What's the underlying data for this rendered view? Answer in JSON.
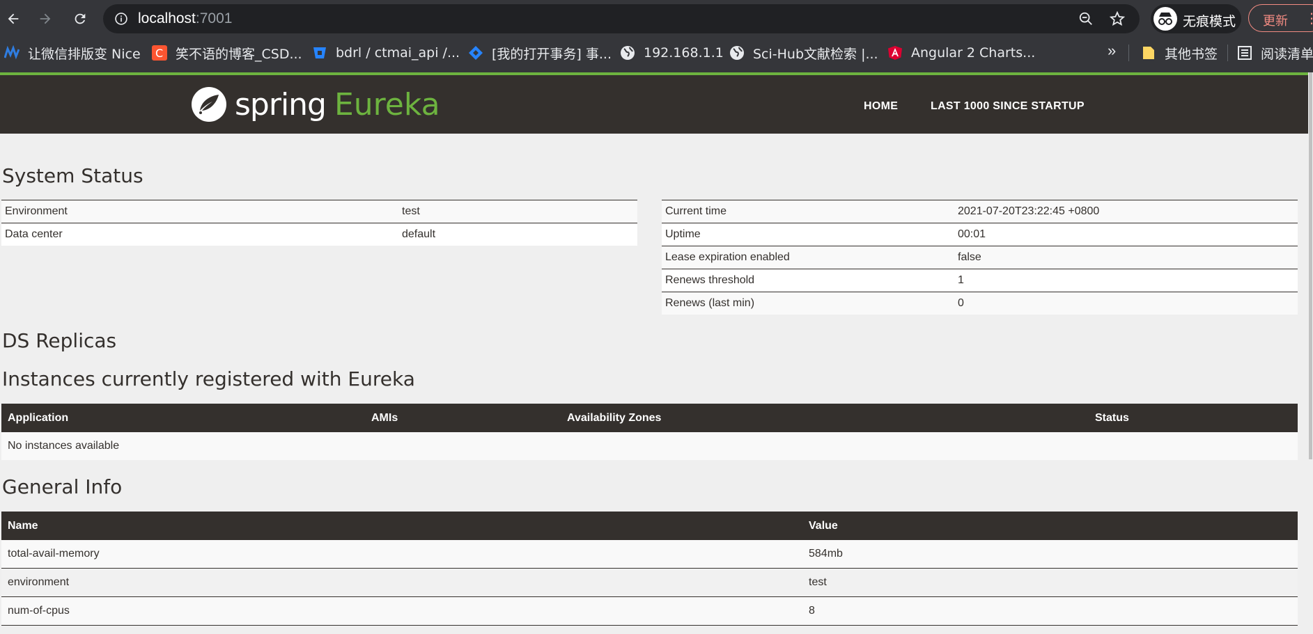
{
  "browser": {
    "url_host": "localhost",
    "url_port": ":7001",
    "profile_label": "无痕模式",
    "update_label": "更新",
    "bookmarks": [
      {
        "label": "让微信排版变 Nice",
        "icon": "nice-icon",
        "color": "#1e6fd9"
      },
      {
        "label": "笑不语的博客_CSD...",
        "icon": "csdn-icon",
        "color": "#fc5531"
      },
      {
        "label": "bdrl / ctmai_api /...",
        "icon": "bitbucket-icon",
        "color": "#2684ff"
      },
      {
        "label": "[我的打开事务] 事...",
        "icon": "jira-icon",
        "color": "#2684ff"
      },
      {
        "label": "192.168.1.1",
        "icon": "globe-icon",
        "color": "#e8eaed"
      },
      {
        "label": "Sci-Hub文献检索 |...",
        "icon": "globe-icon",
        "color": "#e8eaed"
      },
      {
        "label": "Angular 2 Charts...",
        "icon": "angular-icon",
        "color": "#dd0031"
      }
    ],
    "more_label": "»",
    "other_bookmarks": "其他书签",
    "reading_list": "阅读清单"
  },
  "eureka": {
    "logo_spring": "spring",
    "logo_eureka": "Eureka",
    "nav": {
      "home": "HOME",
      "last1000": "LAST 1000 SINCE STARTUP"
    },
    "system_status": {
      "title": "System Status",
      "left": [
        {
          "label": "Environment",
          "value": "test"
        },
        {
          "label": "Data center",
          "value": "default"
        }
      ],
      "right": [
        {
          "label": "Current time",
          "value": "2021-07-20T23:22:45 +0800"
        },
        {
          "label": "Uptime",
          "value": "00:01"
        },
        {
          "label": "Lease expiration enabled",
          "value": "false"
        },
        {
          "label": "Renews threshold",
          "value": "1"
        },
        {
          "label": "Renews (last min)",
          "value": "0"
        }
      ]
    },
    "ds_replicas": {
      "title": "DS Replicas"
    },
    "instances": {
      "title": "Instances currently registered with Eureka",
      "headers": [
        "Application",
        "AMIs",
        "Availability Zones",
        "Status"
      ],
      "empty": "No instances available"
    },
    "general_info": {
      "title": "General Info",
      "headers": [
        "Name",
        "Value"
      ],
      "rows": [
        {
          "name": "total-avail-memory",
          "value": "584mb"
        },
        {
          "name": "environment",
          "value": "test"
        },
        {
          "name": "num-of-cpus",
          "value": "8"
        }
      ]
    },
    "colors": {
      "brand_green": "#6db33f",
      "header_dark": "#34302d"
    }
  }
}
